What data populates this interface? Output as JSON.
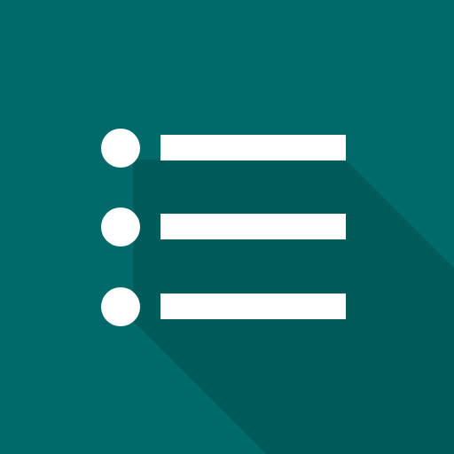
{
  "icon": {
    "name": "list-icon",
    "background_color": "#006a6a",
    "glyph_color": "#ffffff",
    "shadow_color": "#00504f",
    "list_items": 3
  }
}
